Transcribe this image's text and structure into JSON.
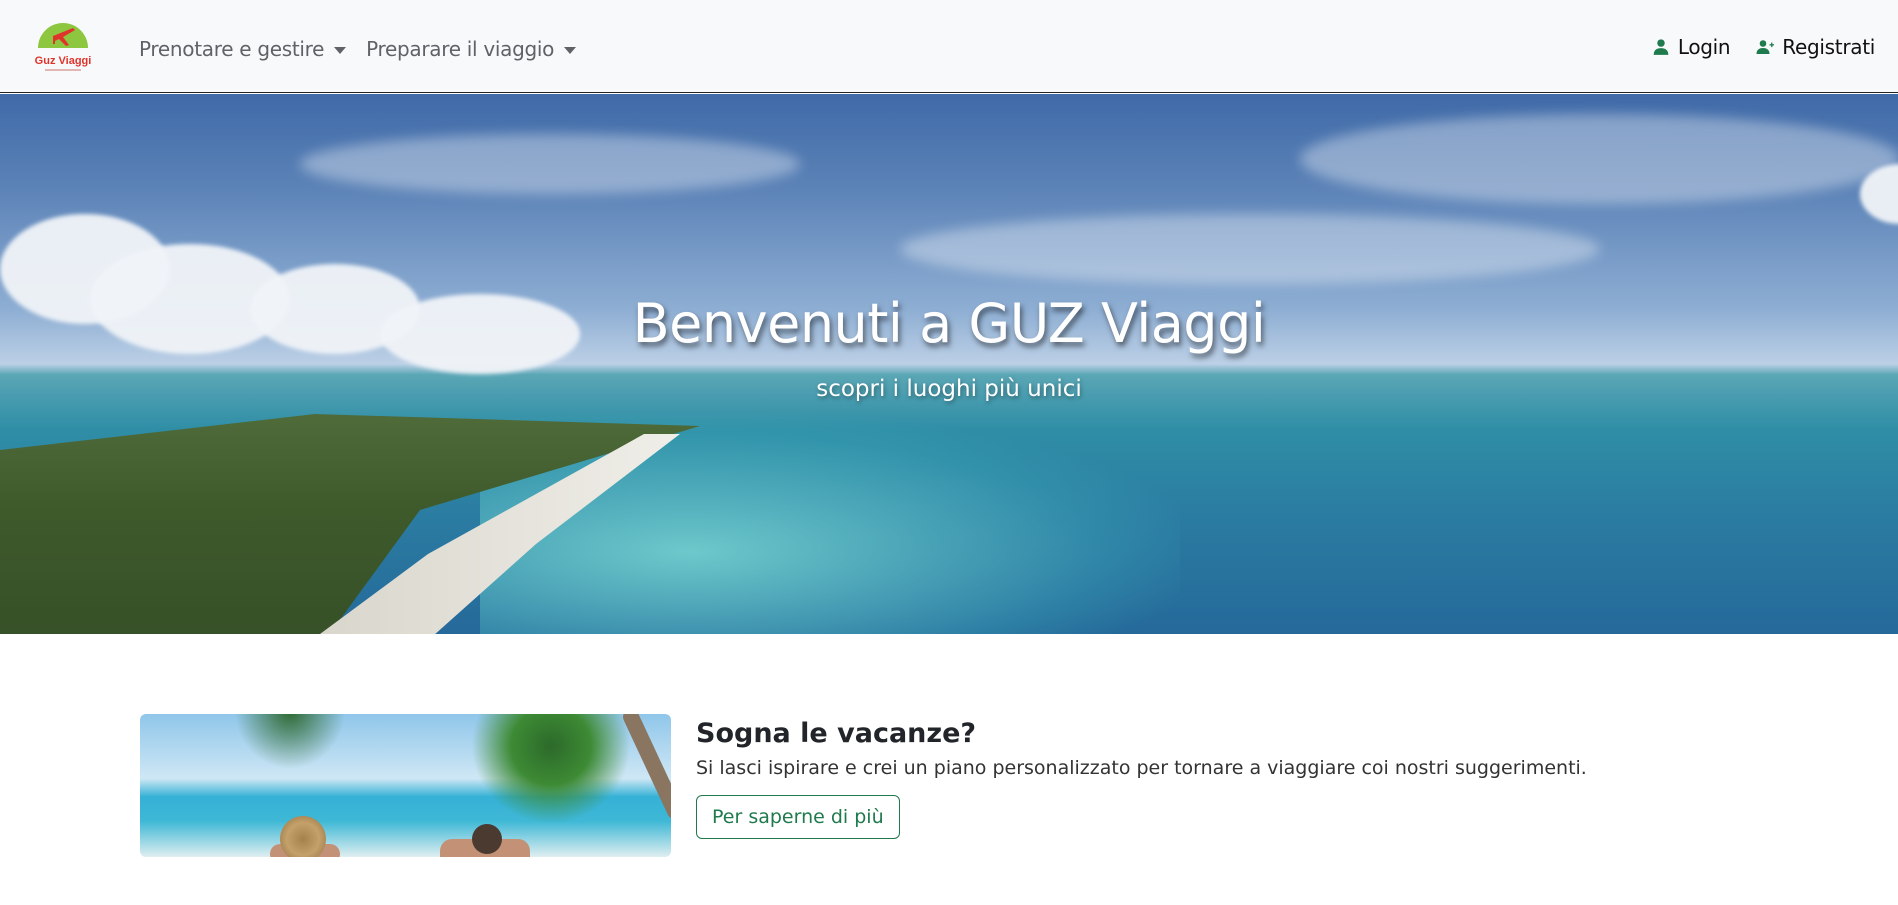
{
  "brand": {
    "logo_text": "Guz Viaggi",
    "accent": "#8dc63f",
    "plane_color": "#e0332b"
  },
  "navbar": {
    "menu": [
      {
        "label": "Prenotare e gestire"
      },
      {
        "label": "Preparare il viaggio"
      }
    ],
    "login_label": "Login",
    "register_label": "Registrati",
    "icon_color": "#1f7a4d"
  },
  "hero": {
    "title": "Benvenuti a GUZ Viaggi",
    "subtitle": "scopri i luoghi più unici"
  },
  "feature": {
    "title": "Sogna le vacanze?",
    "text": "Si lasci ispirare e crei un piano personalizzato per tornare a viaggiare coi nostri suggerimenti.",
    "button_label": "Per saperne di più",
    "button_color": "#1f7a4d"
  }
}
